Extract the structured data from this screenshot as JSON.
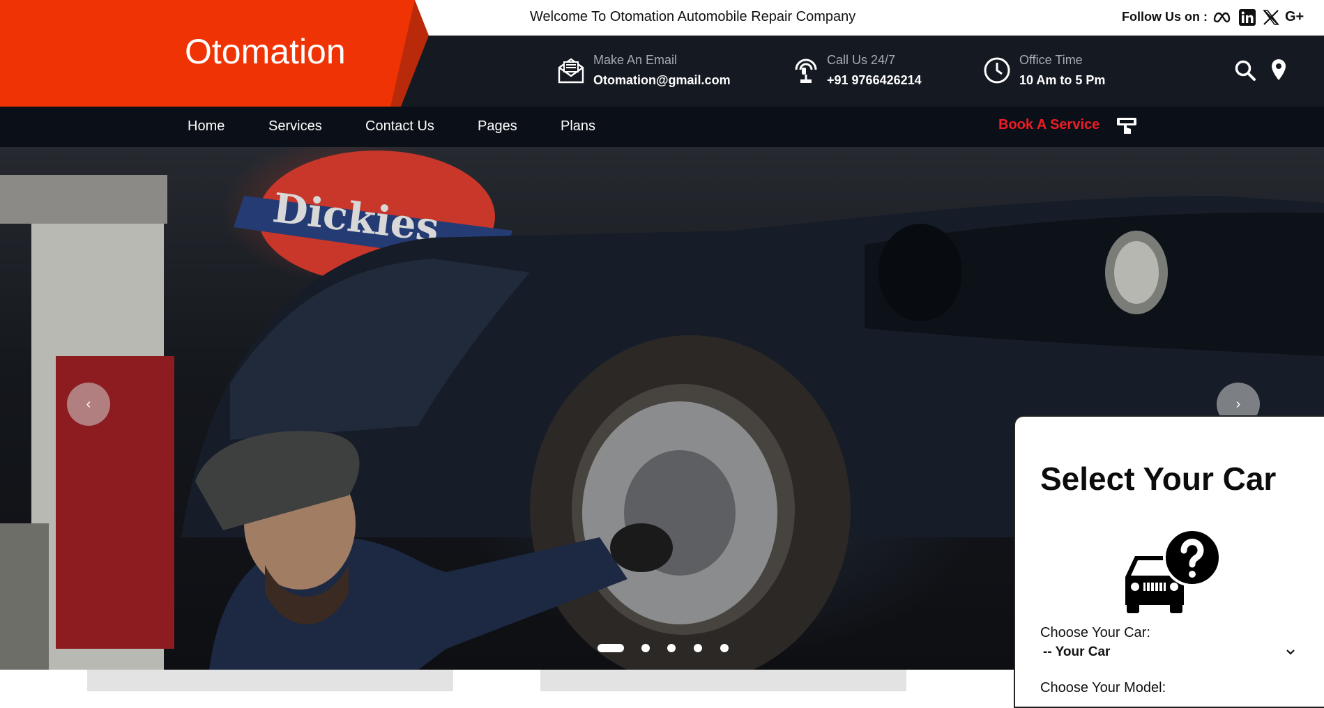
{
  "topbar": {
    "welcome": "Welcome To Otomation Automobile Repair Company",
    "follow_label": "Follow Us on :",
    "social_icons": [
      "meta-icon",
      "linkedin-icon",
      "x-twitter-icon",
      "google-plus-icon"
    ]
  },
  "logo": {
    "text": "Otomation"
  },
  "header": {
    "email": {
      "label": "Make An Email",
      "value": "Otomation@gmail.com"
    },
    "call": {
      "label": "Call Us 24/7",
      "value": "+91 9766426214"
    },
    "office": {
      "label": "Office Time",
      "value": "10 Am to 5 Pm"
    }
  },
  "nav": {
    "items": [
      "Home",
      "Services",
      "Contact Us",
      "Pages",
      "Plans"
    ],
    "book_label": "Book A Service"
  },
  "hero": {
    "prev_label": "‹",
    "next_label": "›",
    "slide_count": 5,
    "active_slide": 1
  },
  "select_panel": {
    "title": "Select Your Car",
    "choose_car_label": "Choose Your Car:",
    "choose_car_value": "-- Your Car",
    "choose_model_label": "Choose Your Model:"
  },
  "colors": {
    "brand_red": "#ef3304",
    "header_dark": "#151a22",
    "nav_dark": "#0b0f17",
    "book_red": "#ee1c25"
  }
}
